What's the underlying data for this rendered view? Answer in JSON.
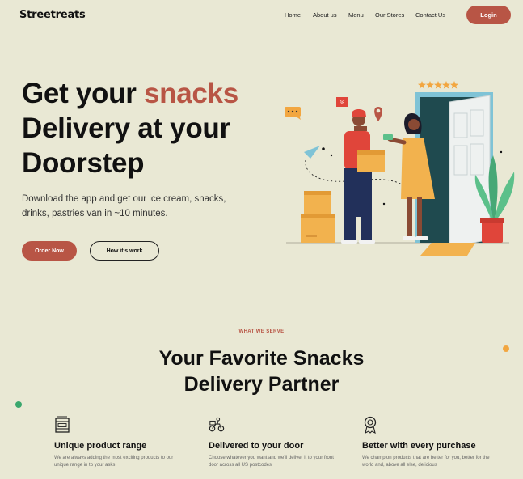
{
  "brand": {
    "name": "Streetreats"
  },
  "nav": {
    "items": [
      "Home",
      "About us",
      "Menu",
      "Our Stores",
      "Contact Us"
    ],
    "login_label": "Login"
  },
  "hero": {
    "title_part1": "Get your ",
    "title_accent": "snacks",
    "title_part2": "Delivery at your Doorstep",
    "subtitle": "Download the app and get our ice cream, snacks, drinks, pastries van in ~10 minutes.",
    "order_label": "Order Now",
    "how_label": "How it's work"
  },
  "serve": {
    "eyebrow": "WHAT WE SERVE",
    "title_line1": "Your Favorite Snacks",
    "title_line2": "Delivery Partner"
  },
  "features": [
    {
      "icon": "box-package-icon",
      "title": "Unique product range",
      "desc": "We are always adding the most exciting products to our unique range in to your asks"
    },
    {
      "icon": "delivery-scooter-icon",
      "title": "Delivered to your door",
      "desc": "Choose whatever you want and we'll deliver it to your front door across all US postcodes"
    },
    {
      "icon": "award-badge-icon",
      "title": "Better with every purchase",
      "desc": "We champion products that are better for you, better for the world and, above all else, delicious"
    }
  ],
  "illustration": {
    "stars": 5,
    "badge_text": "%"
  },
  "colors": {
    "background": "#e9e8d4",
    "accent": "#b85545",
    "green_dot": "#3aa76d",
    "orange_dot": "#f2a640"
  }
}
